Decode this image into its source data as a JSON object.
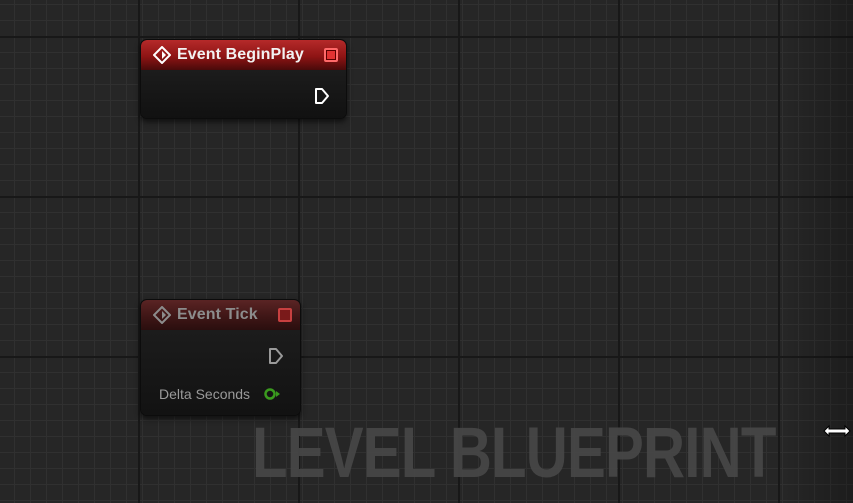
{
  "graph": {
    "watermark": "LEVEL BLUEPRINT"
  },
  "nodes": {
    "begin_play": {
      "title": "Event BeginPlay",
      "icon": "event-diamond-icon",
      "header_color": "#8e1414",
      "delegate_pin": "delegate-pin-icon",
      "exec_out": "exec-output-pin-icon"
    },
    "tick": {
      "title": "Event Tick",
      "icon": "event-diamond-icon",
      "header_color": "#3f1616",
      "delegate_pin": "delegate-pin-icon",
      "exec_out": "exec-output-pin-icon",
      "data_pin_label": "Delta Seconds",
      "data_pin_color": "#3a9a1e"
    }
  },
  "cursor": "resize-horizontal-cursor-icon"
}
